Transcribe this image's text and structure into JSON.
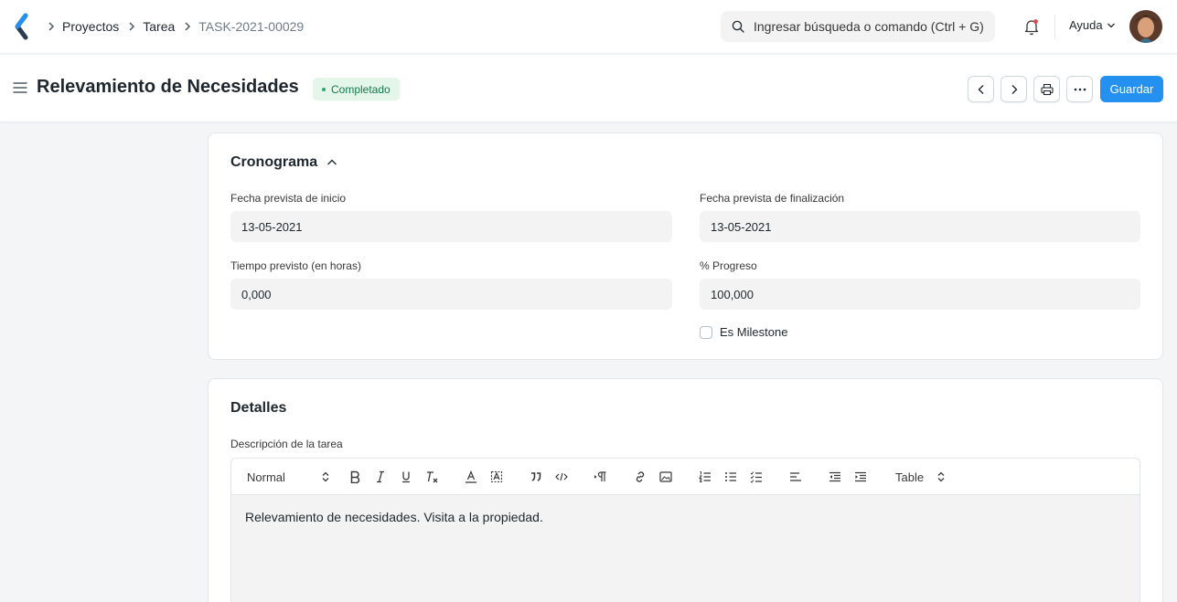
{
  "navbar": {
    "breadcrumbs": [
      "Proyectos",
      "Tarea",
      "TASK-2021-00029"
    ],
    "search_placeholder": "Ingresar búsqueda o comando (Ctrl + G)",
    "help_label": "Ayuda"
  },
  "page": {
    "title": "Relevamiento de Necesidades",
    "status": "Completado",
    "save_label": "Guardar"
  },
  "schedule": {
    "title": "Cronograma",
    "fields": {
      "start_label": "Fecha prevista de inicio",
      "start_value": "13-05-2021",
      "end_label": "Fecha prevista de finalización",
      "end_value": "13-05-2021",
      "hours_label": "Tiempo previsto (en horas)",
      "hours_value": "0,000",
      "progress_label": "% Progreso",
      "progress_value": "100,000",
      "milestone_label": "Es Milestone"
    }
  },
  "details": {
    "title": "Detalles",
    "description_label": "Descripción de la tarea",
    "toolbar": {
      "format_select": "Normal",
      "table_select": "Table"
    },
    "description_text": "Relevamiento de necesidades. Visita a la propiedad."
  },
  "colors": {
    "primary": "#2490ef",
    "status_bg": "#e4f5e9",
    "status_text": "#16794c",
    "notification_dot": "#e24c4c"
  }
}
